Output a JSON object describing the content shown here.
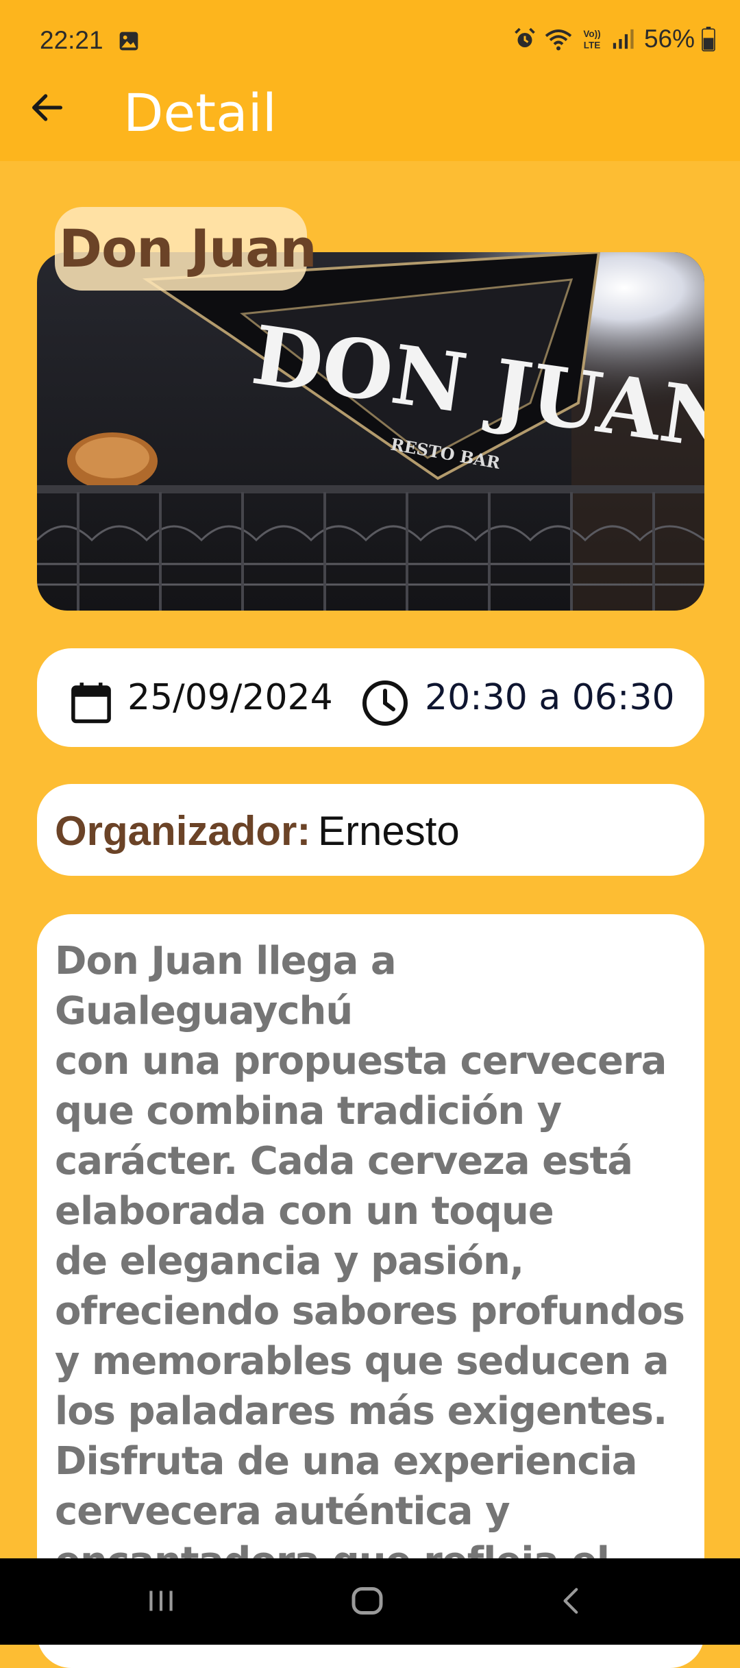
{
  "status_bar": {
    "time": "22:21",
    "battery": "56%",
    "icons": [
      "gallery-icon",
      "alarm-icon",
      "wifi-icon",
      "volte-icon",
      "signal-icon",
      "battery-icon"
    ]
  },
  "app_bar": {
    "title": "Detail",
    "back_icon": "arrow-left-icon"
  },
  "event": {
    "name": "Don Juan",
    "image_sign_text": "DON JUAN",
    "image_sub_text": "RESTO BAR",
    "date": "25/09/2024",
    "hours": "20:30 a 06:30",
    "organizer_label": "Organizador:",
    "organizer": "Ernesto",
    "description": "Don Juan llega a Gualeguaychú\ncon una propuesta cervecera\nque combina tradición y\ncarácter. Cada cerveza está\nelaborada con un toque\nde elegancia y pasión,\nofreciendo sabores profundos\ny memorables que seducen a\nlos paladares más exigentes.\nDisfruta de una experiencia\ncervecera auténtica y\nencantadora que refleja el\nespíritu audaz de Don Juan."
  },
  "nav_bar": {
    "icons": [
      "recents-icon",
      "home-icon",
      "back-icon"
    ]
  },
  "colors": {
    "background": "#FDBD33",
    "app_bar": "#FDB51D",
    "accent_brown": "#6B4327",
    "card": "#FFFFFF"
  }
}
